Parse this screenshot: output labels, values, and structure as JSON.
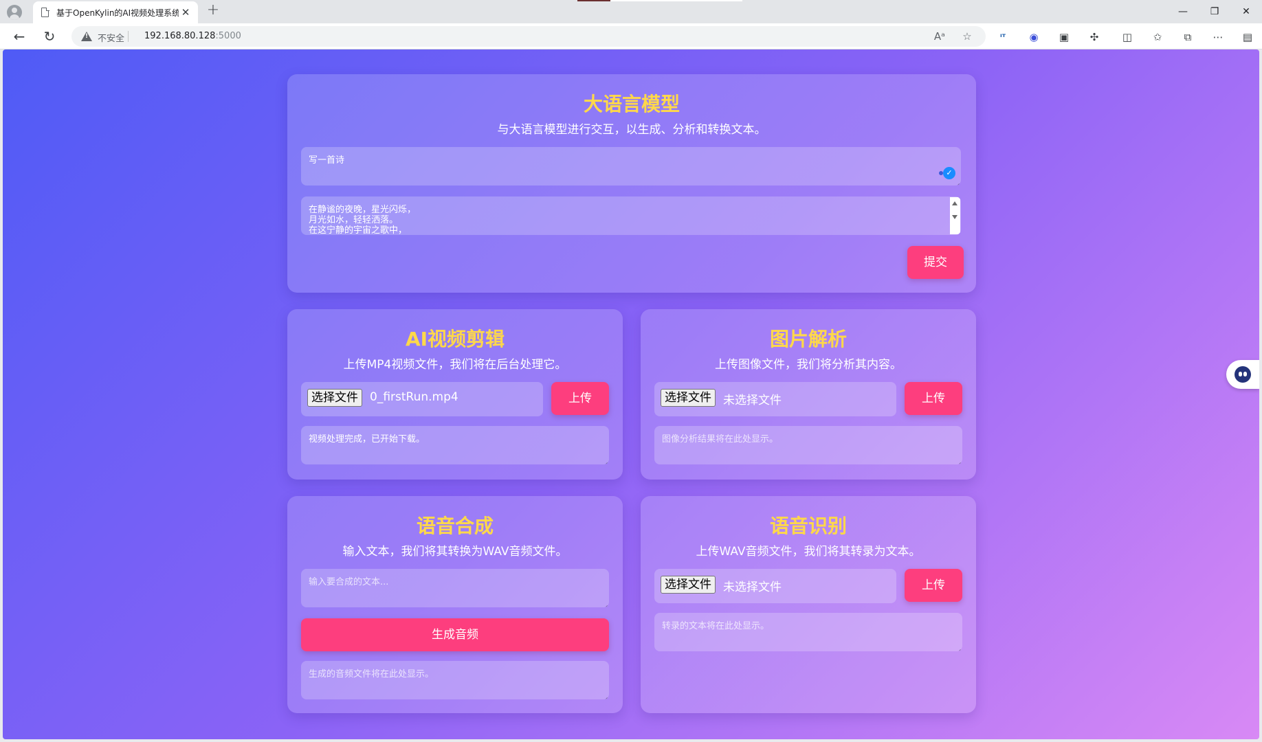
{
  "browser": {
    "tab_title": "基于OpenKylin的AI视频处理系统",
    "tab_close": "✕",
    "new_tab": "+",
    "security_label": "不安全",
    "url_host": "192.168.80.128",
    "url_port": ":5000",
    "window_controls": {
      "minimize": "—",
      "restore": "❐",
      "close": "✕"
    },
    "icons": [
      "back-icon",
      "refresh-icon",
      "read-aloud-icon",
      "favorite-icon",
      "translate-icon",
      "copilot-icon",
      "collections-icon",
      "extensions-icon",
      "split-screen-icon",
      "favorites-bar-icon",
      "tab-collections-icon",
      "more-icon",
      "sidebar-icon"
    ]
  },
  "llm": {
    "title": "大语言模型",
    "description": "与大语言模型进行交互，以生成、分析和转换文本。",
    "prompt_value": "写一首诗",
    "output_lines": [
      "在静谧的夜晚，星光闪烁，",
      "月光如水，轻轻洒落。",
      "在这宁静的宇宙之歌中，"
    ],
    "submit_label": "提交"
  },
  "video_edit": {
    "title": "AI视频剪辑",
    "description": "上传MP4视频文件，我们将在后台处理它。",
    "choose_file_label": "选择文件",
    "file_name": "0_firstRun.mp4",
    "upload_label": "上传",
    "result_text": "视频处理完成，已开始下载。"
  },
  "image_analysis": {
    "title": "图片解析",
    "description": "上传图像文件，我们将分析其内容。",
    "choose_file_label": "选择文件",
    "file_name": "未选择文件",
    "upload_label": "上传",
    "result_placeholder": "图像分析结果将在此处显示。"
  },
  "tts": {
    "title": "语音合成",
    "description": "输入文本，我们将其转换为WAV音频文件。",
    "input_placeholder": "输入要合成的文本...",
    "generate_label": "生成音频",
    "result_placeholder": "生成的音频文件将在此处显示。"
  },
  "asr": {
    "title": "语音识别",
    "description": "上传WAV音频文件，我们将其转录为文本。",
    "choose_file_label": "选择文件",
    "file_name": "未选择文件",
    "upload_label": "上传",
    "result_placeholder": "转录的文本将在此处显示。"
  },
  "colors": {
    "title_yellow": "#ffd84a",
    "button_pink": "#fd3e7e",
    "gradient_start": "#4f5bf6",
    "gradient_end": "#d889f5"
  }
}
